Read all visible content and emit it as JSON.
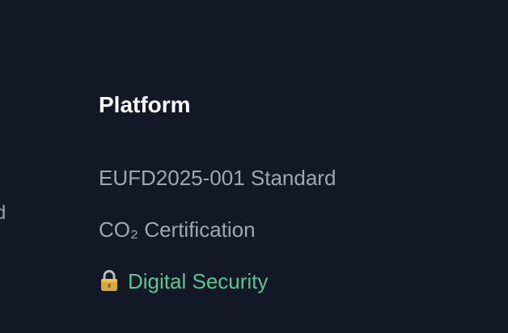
{
  "edge_fragment": "d",
  "footer": {
    "heading": "Platform",
    "links": [
      {
        "label": "EUFD2025-001 Standard"
      },
      {
        "label": "CO₂ Certification"
      },
      {
        "label": "Digital Security",
        "icon": "lock-icon",
        "color": "#5bc48f"
      }
    ]
  }
}
